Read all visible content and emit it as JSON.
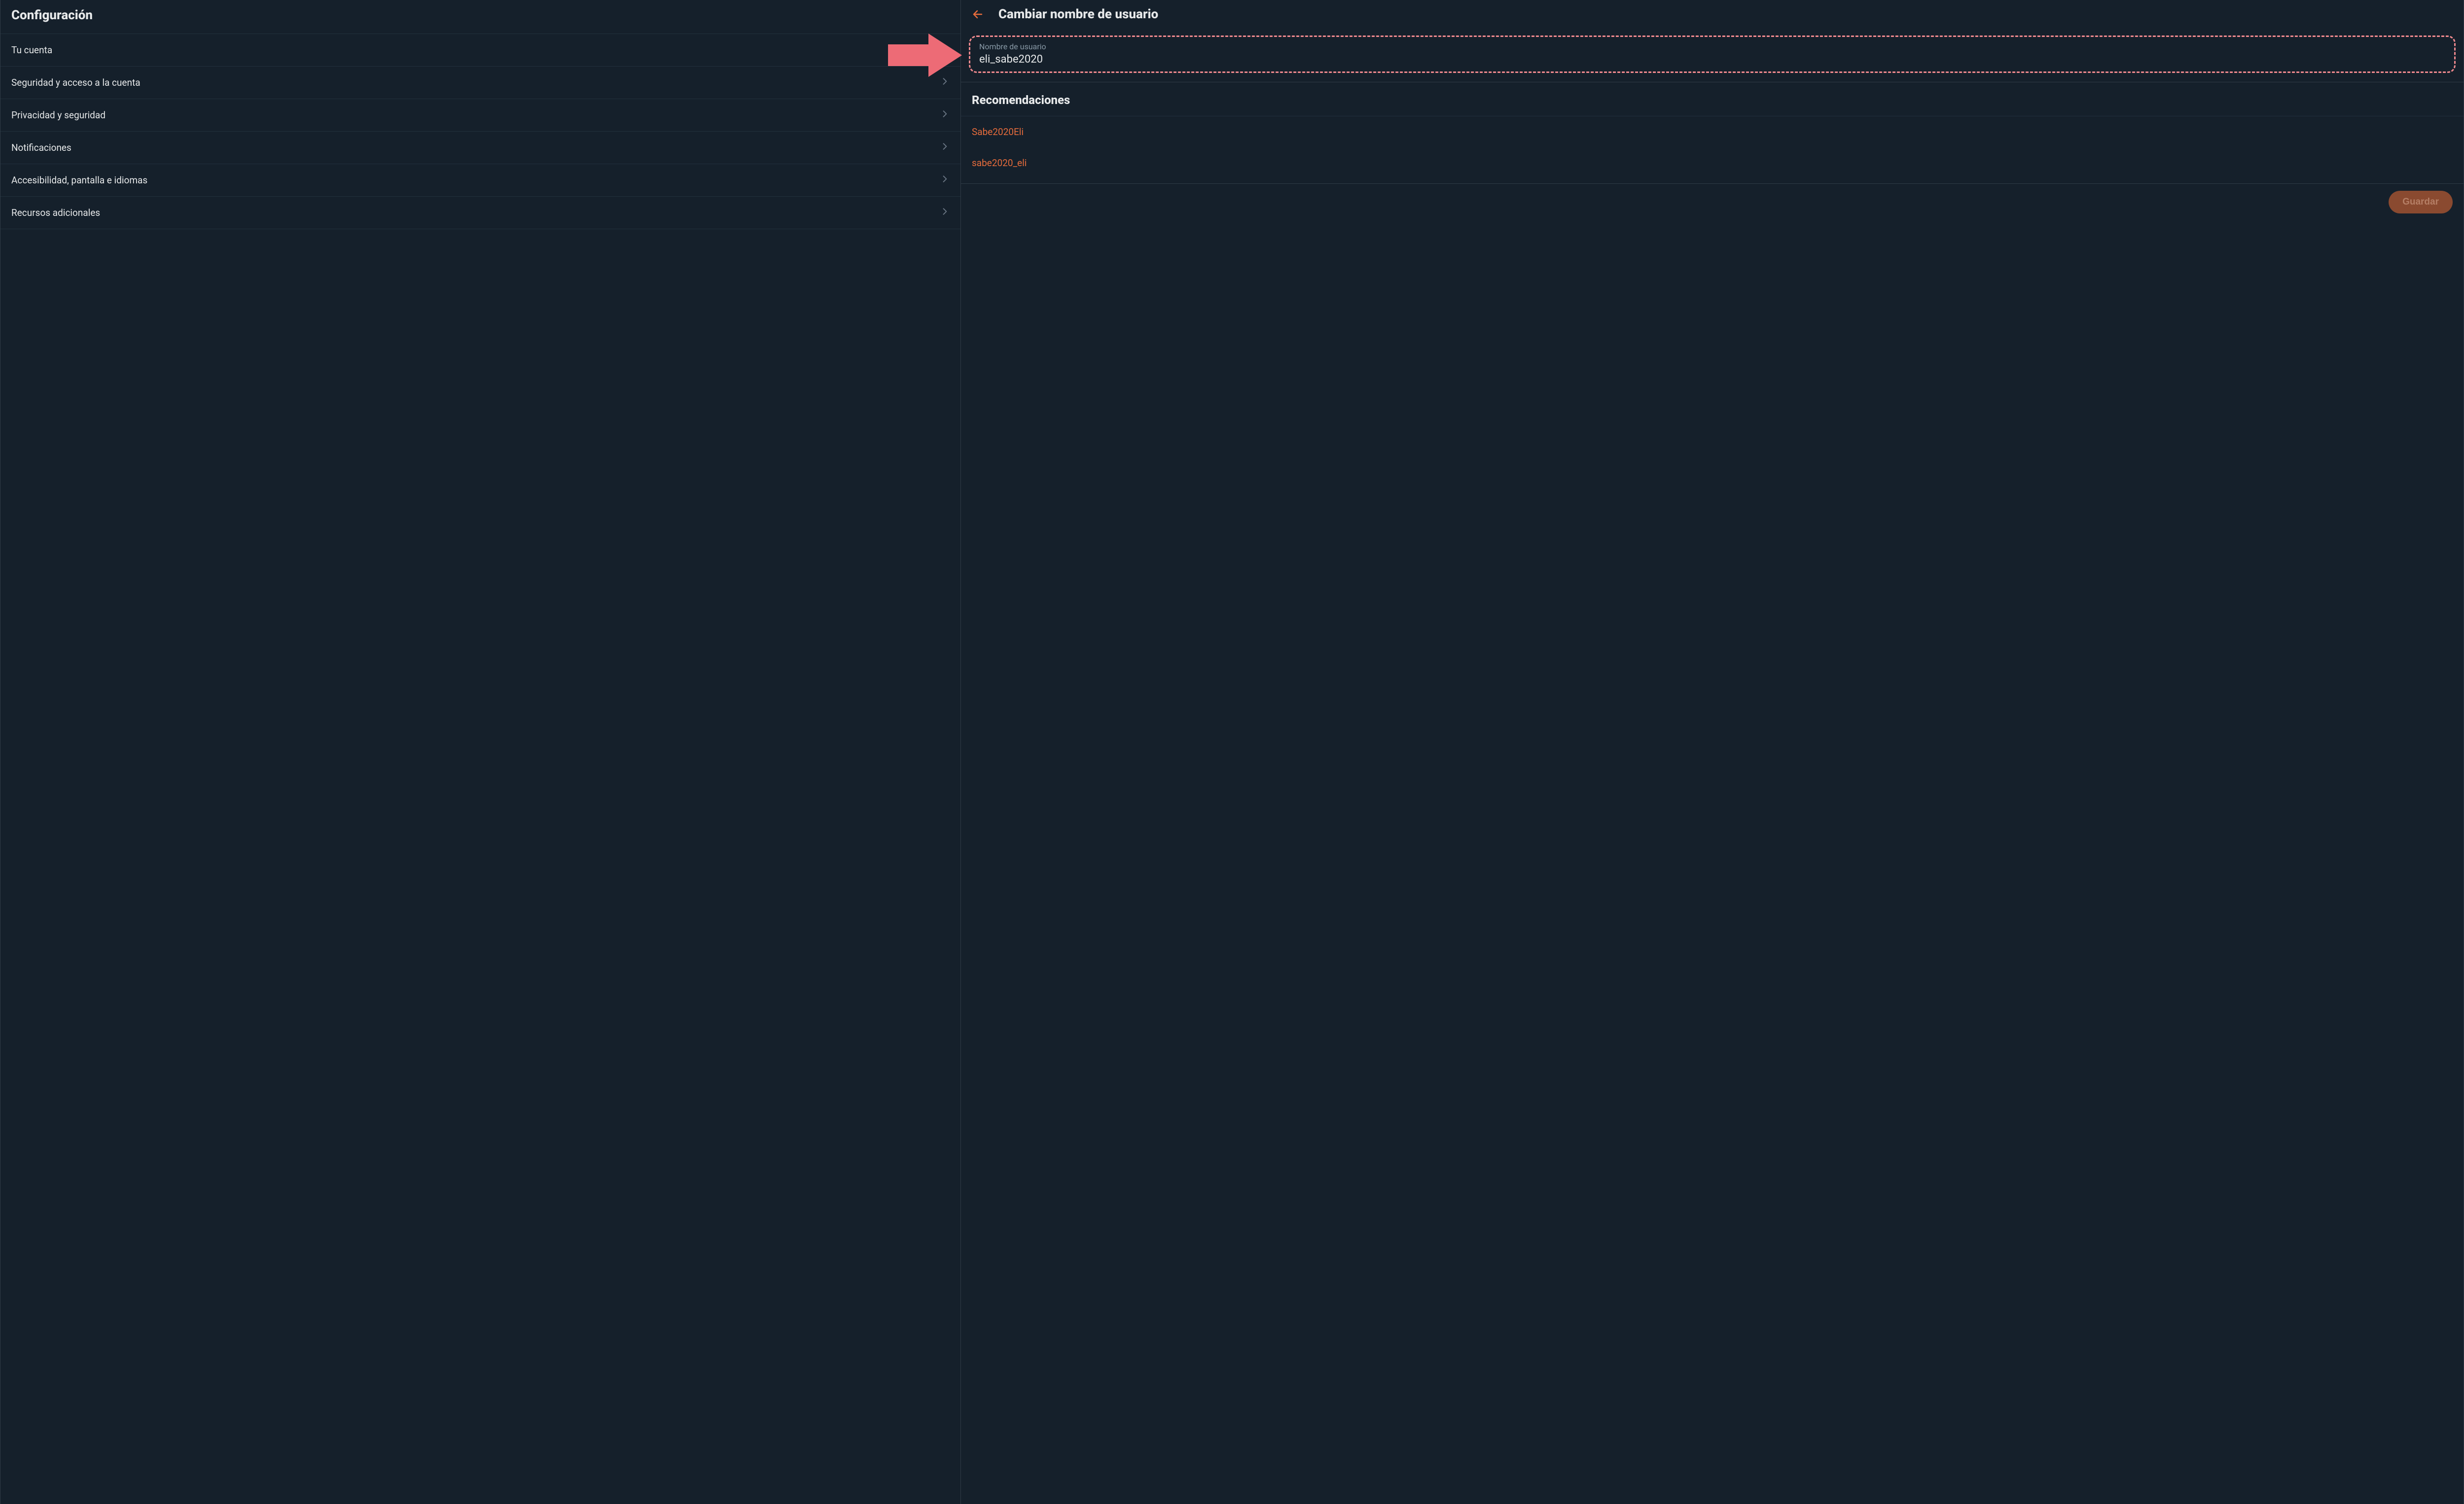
{
  "sidebar": {
    "title": "Configuración",
    "items": [
      {
        "label": "Tu cuenta"
      },
      {
        "label": "Seguridad y acceso a la cuenta"
      },
      {
        "label": "Privacidad y seguridad"
      },
      {
        "label": "Notificaciones"
      },
      {
        "label": "Accesibilidad, pantalla e idiomas"
      },
      {
        "label": "Recursos adicionales"
      }
    ]
  },
  "main": {
    "title": "Cambiar nombre de usuario",
    "username_field": {
      "label": "Nombre de usuario",
      "value": "eli_sabe2020"
    },
    "recommendations_title": "Recomendaciones",
    "recommendations": [
      "Sabe2020Eli",
      "sabe2020_eli"
    ],
    "save_label": "Guardar"
  },
  "colors": {
    "background": "#15202b",
    "border": "#2f3b46",
    "text": "#e7e9ea",
    "muted": "#8899a6",
    "accent": "#e66c3c",
    "highlight_dash": "#f18a8f",
    "pointer": "#ed6b76"
  }
}
